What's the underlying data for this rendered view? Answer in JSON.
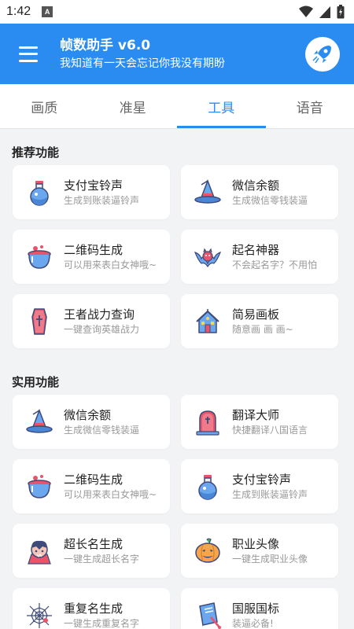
{
  "status_bar": {
    "time": "1:42",
    "sim_label": "A"
  },
  "app_bar": {
    "title": "帧数助手 v6.0",
    "subtitle": "我知道有一天会忘记你我没有期盼",
    "logo_text": "帧数助手"
  },
  "tabs": [
    {
      "label": "画质"
    },
    {
      "label": "准星"
    },
    {
      "label": "工具",
      "active": true
    },
    {
      "label": "语音"
    }
  ],
  "sections": [
    {
      "title": "推荐功能",
      "items": [
        {
          "title": "支付宝铃声",
          "subtitle": "生成到账装逼铃声",
          "icon": "potion-icon"
        },
        {
          "title": "微信余额",
          "subtitle": "生成微信零钱装逼",
          "icon": "witch-hat-icon"
        },
        {
          "title": "二维码生成",
          "subtitle": "可以用来表白女神哦~",
          "icon": "cauldron-icon"
        },
        {
          "title": "起名神器",
          "subtitle": "不会起名字？不用怕",
          "icon": "bat-icon"
        },
        {
          "title": "王者战力查询",
          "subtitle": "一键查询英雄战力",
          "icon": "coffin-icon"
        },
        {
          "title": "简易画板",
          "subtitle": "随意画 画 画~",
          "icon": "haunted-house-icon"
        }
      ]
    },
    {
      "title": "实用功能",
      "items": [
        {
          "title": "微信余额",
          "subtitle": "生成微信零钱装逼",
          "icon": "witch-hat-icon"
        },
        {
          "title": "翻译大师",
          "subtitle": "快捷翻译八国语言",
          "icon": "tombstone-icon"
        },
        {
          "title": "二维码生成",
          "subtitle": "可以用来表白女神哦~",
          "icon": "cauldron-icon"
        },
        {
          "title": "支付宝铃声",
          "subtitle": "生成到账装逼铃声",
          "icon": "potion-icon"
        },
        {
          "title": "超长名生成",
          "subtitle": "一键生成超长名字",
          "icon": "vampire-icon"
        },
        {
          "title": "职业头像",
          "subtitle": "一键生成职业头像",
          "icon": "pumpkin-icon"
        },
        {
          "title": "重复名生成",
          "subtitle": "一键生成重复名字",
          "icon": "spider-web-icon"
        },
        {
          "title": "国服国标",
          "subtitle": "装逼必备!",
          "icon": "spellbook-icon"
        }
      ]
    }
  ],
  "colors": {
    "primary": "#2a8cf0",
    "background": "#f2f3f5",
    "icon_dark": "#3d4a7a",
    "icon_red": "#e9546b",
    "icon_blue": "#6aa7ef"
  }
}
